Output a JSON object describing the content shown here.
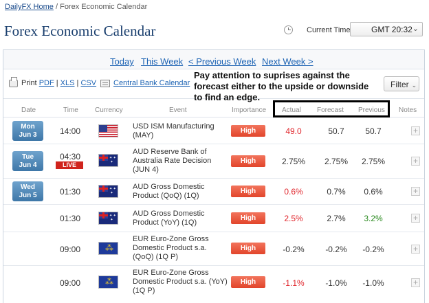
{
  "breadcrumb": {
    "home": "DailyFX Home",
    "separator": "/",
    "current": "Forex Economic Calendar"
  },
  "page_title": "Forex Economic Calendar",
  "current_time": {
    "label": "Current Time:",
    "value": "GMT 20:32",
    "caret": "⌄"
  },
  "nav": {
    "today": "Today",
    "this_week": "This Week",
    "prev_week": "< Previous Week",
    "next_week": "Next Week >"
  },
  "tools": {
    "print": "Print",
    "pdf": "PDF",
    "xls": "XLS",
    "csv": "CSV",
    "sep": "|",
    "central_bank": "Central Bank Calendar",
    "filter": "Filter",
    "filter_caret": "⌄"
  },
  "annotation": "Pay attention to suprises against the forecast either to the upside or downside to find an edge.",
  "headers": {
    "date": "Date",
    "time": "Time",
    "currency": "Currency",
    "event": "Event",
    "importance": "Importance",
    "actual": "Actual",
    "forecast": "Forecast",
    "previous": "Previous",
    "notes": "Notes"
  },
  "rows": [
    {
      "date_day": "Mon",
      "date": "Jun 3",
      "time": "14:00",
      "flag": "US",
      "event": "USD ISM Manufacturing (MAY)",
      "importance": "High",
      "actual": "49.0",
      "forecast": "50.7",
      "previous": "50.7",
      "notes_button": "+"
    },
    {
      "date_day": "Tue",
      "date": "Jun 4",
      "time": "04:30",
      "live": "LIVE",
      "flag": "AU",
      "event": "AUD Reserve Bank of Australia Rate Decision (JUN 4)",
      "importance": "High",
      "actual": "2.75%",
      "forecast": "2.75%",
      "previous": "2.75%",
      "notes_button": "+"
    },
    {
      "date_day": "Wed",
      "date": "Jun 5",
      "time": "01:30",
      "flag": "AU",
      "event": "AUD Gross Domestic Product (QoQ) (1Q)",
      "importance": "High",
      "actual": "0.6%",
      "forecast": "0.7%",
      "previous": "0.6%",
      "notes_button": "+"
    },
    {
      "time": "01:30",
      "flag": "AU",
      "event": "AUD Gross Domestic Product (YoY) (1Q)",
      "importance": "High",
      "actual": "2.5%",
      "forecast": "2.7%",
      "previous": "3.2%",
      "notes_button": "+"
    },
    {
      "time": "09:00",
      "flag": "EU",
      "event": "EUR Euro-Zone Gross Domestic Product s.a. (QoQ) (1Q P)",
      "importance": "High",
      "actual": "-0.2%",
      "forecast": "-0.2%",
      "previous": "-0.2%",
      "notes_button": "+"
    },
    {
      "time": "09:00",
      "flag": "EU",
      "event": "EUR Euro-Zone Gross Domestic Product s.a. (YoY) (1Q P)",
      "importance": "High",
      "actual": "-1.1%",
      "forecast": "-1.0%",
      "previous": "-1.0%",
      "notes_button": "+"
    }
  ],
  "colors": {
    "importance_high": "#e2452b",
    "actual_miss": "#e0252b",
    "actual_beat": "#2a8a1f",
    "date_badge": "#3e77a8",
    "live": "#d0241d"
  }
}
